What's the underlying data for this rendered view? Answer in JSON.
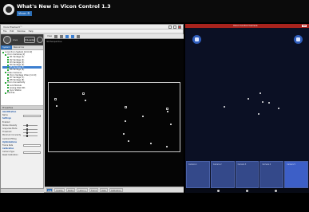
{
  "video": {
    "title": "What's New in Vicon Control 1.3",
    "subtitle": "Vicon ®"
  },
  "app": {
    "window_title": "ViconTracker3™",
    "menu": [
      "File",
      "Edit",
      "Window",
      "Help"
    ],
    "system": {
      "label": "Live",
      "pill": "UnLoaded"
    },
    "tabs": [
      "System",
      "Resources"
    ],
    "tree": [
      {
        "label": "Local Vicon System [2.0.0.0]",
        "indent": 0,
        "selected": false
      },
      {
        "label": "Vicon Cameras [2]",
        "indent": 1,
        "selected": false
      },
      {
        "label": "#1 Vantage (1)",
        "indent": 2,
        "selected": false
      },
      {
        "label": "#2 Vantage (2)",
        "indent": 2,
        "selected": false
      },
      {
        "label": "#3 Vantage (3)",
        "indent": 2,
        "selected": false
      },
      {
        "label": "#4 Vantage (4)",
        "indent": 2,
        "selected": false
      },
      {
        "label": "#5 Vantage (5)",
        "indent": 2,
        "selected": true
      },
      {
        "label": "#6 Vantage (6)",
        "indent": 2,
        "selected": false
      },
      {
        "label": "Video Cameras",
        "indent": 1,
        "selected": false
      },
      {
        "label": "Vicon Vantage Video [1.0.0]",
        "indent": 2,
        "selected": false
      },
      {
        "label": "#7 Vantage (7)",
        "indent": 2,
        "selected": false
      },
      {
        "label": "#8 Vantage (8)",
        "indent": 2,
        "selected": false
      },
      {
        "label": "Vicon Connectivity",
        "indent": 1,
        "selected": false
      },
      {
        "label": "Lock Module",
        "indent": 2,
        "selected": false
      },
      {
        "label": "Analog DAQ 001",
        "indent": 2,
        "selected": false
      },
      {
        "label": "Sync Station",
        "indent": 2,
        "selected": false
      },
      {
        "label": "Devices",
        "indent": 1,
        "selected": false
      }
    ],
    "properties_title": "Properties",
    "properties": [
      {
        "label": "Identification",
        "type": "section"
      },
      {
        "label": "Name",
        "type": "field"
      },
      {
        "label": "Settings",
        "type": "section"
      },
      {
        "label": "Enabled",
        "type": "text"
      },
      {
        "label": "Strobe Intensity",
        "type": "slider"
      },
      {
        "label": "Grayscale Mode",
        "type": "slider"
      },
      {
        "label": "Threshold",
        "type": "slider"
      },
      {
        "label": "Minimum Circularity",
        "type": "slider"
      },
      {
        "label": "Centroid Fitting",
        "type": "text"
      },
      {
        "label": "Optimizations",
        "type": "section"
      },
      {
        "label": "Frame Rate",
        "type": "field"
      },
      {
        "label": "Calibration",
        "type": "section"
      },
      {
        "label": "Camera Type",
        "type": "field"
      },
      {
        "label": "Reset Calibration",
        "type": "text"
      }
    ],
    "viewport": {
      "mode": "3D Perspective",
      "view_label": "View"
    },
    "status_tabs": [
      "Log",
      "Quality",
      "Status",
      "Latency",
      "Frame",
      "Rate",
      "Calibration"
    ],
    "status_active": 0
  },
  "tablet": {
    "header": "Vicon Control Camera",
    "tiles": [
      "Camera 1",
      "Camera 2",
      "Camera 3",
      "Camera 4",
      "Camera 5"
    ],
    "active_tile": 4
  }
}
